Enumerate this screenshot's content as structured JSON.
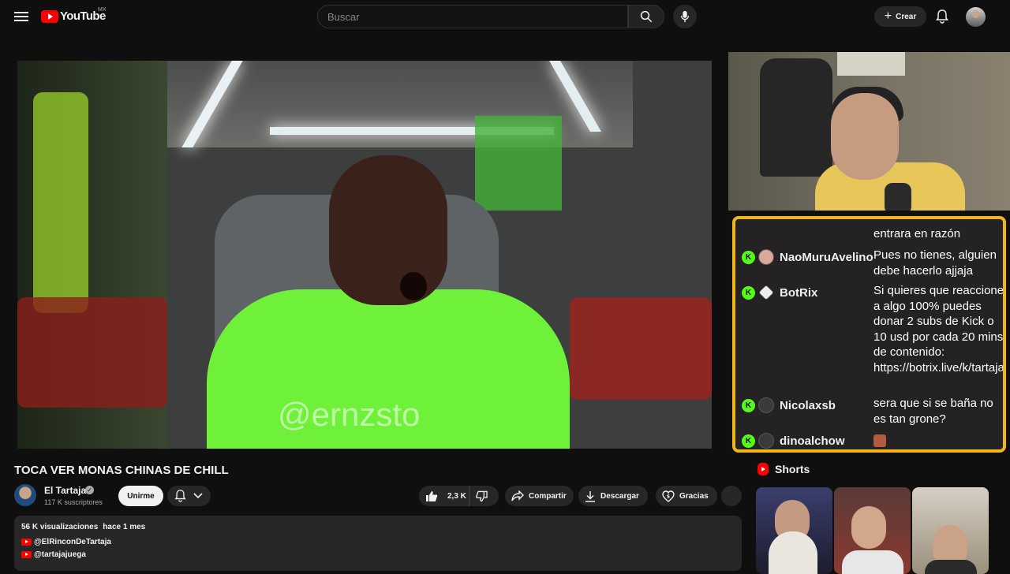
{
  "header": {
    "logo_text": "YouTube",
    "country": "MX",
    "search_placeholder": "Buscar",
    "create_label": "Crear",
    "icons": [
      "menu-icon",
      "search-icon",
      "microphone-icon",
      "plus-icon",
      "bell-icon"
    ]
  },
  "player": {
    "watermark": "@ernzsto"
  },
  "chat": {
    "border_color": "#f2b51a",
    "badge_color": "#53fc18",
    "partial_message": "entrara en razón",
    "messages": [
      {
        "user": "NaoMuruAvelino",
        "text": "Pues no tienes, alguien debe hacerlo ajjaja"
      },
      {
        "user": "BotRix",
        "text": "Si quieres que reaccione a algo 100% puedes donar 2 subs de Kick o 10 usd por cada 20 mins de contenido: https://botrix.live/k/tartaja/tip"
      },
      {
        "user": "Nicolaxsb",
        "text": "sera que si se baña no es tan grone?"
      },
      {
        "user": "dinoalchow",
        "text": ""
      }
    ]
  },
  "video": {
    "title": "TOCA VER MONAS CHINAS DE CHILL",
    "channel": "El Tartaja",
    "subscribers": "117 K suscriptores",
    "join_label": "Unirme",
    "likes": "2,3 K",
    "share_label": "Compartir",
    "download_label": "Descargar",
    "thanks_label": "Gracias"
  },
  "description": {
    "views": "56 K visualizaciones",
    "date": "hace 1 mes",
    "links": [
      "@ElRinconDeTartaja",
      "@tartajajuega"
    ]
  },
  "shorts": {
    "title": "Shorts"
  }
}
